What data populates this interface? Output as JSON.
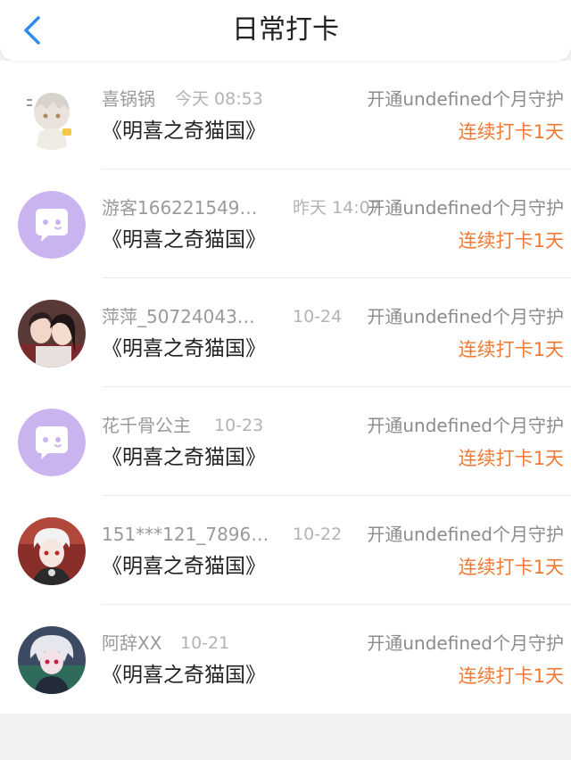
{
  "header": {
    "title": "日常打卡",
    "back_icon": "chevron-left-icon",
    "accent": "#2f8cf0"
  },
  "colors": {
    "streak": "#f07a35",
    "name": "#9a9a9a",
    "time": "#b3b3b3"
  },
  "items": [
    {
      "name": "喜锅锅",
      "time": "今天 08:53",
      "game": "《明喜之奇猫国》",
      "guard": "开通undefined个月守护",
      "streak": "连续打卡1天",
      "avatar": "anime-avatar-icon"
    },
    {
      "name": "游客166221549…",
      "time": "昨天 14:07",
      "game": "《明喜之奇猫国》",
      "guard": "开通undefined个月守护",
      "streak": "连续打卡1天",
      "avatar": "default-chat-avatar-icon"
    },
    {
      "name": "萍萍_50724043…",
      "time": "10-24",
      "game": "《明喜之奇猫国》",
      "guard": "开通undefined个月守护",
      "streak": "连续打卡1天",
      "avatar": "photo-avatar-icon"
    },
    {
      "name": "花千骨公主",
      "time": "10-23",
      "game": "《明喜之奇猫国》",
      "guard": "开通undefined个月守护",
      "streak": "连续打卡1天",
      "avatar": "default-chat-avatar-icon"
    },
    {
      "name": "151***121_7896…",
      "time": "10-22",
      "game": "《明喜之奇猫国》",
      "guard": "开通undefined个月守护",
      "streak": "连续打卡1天",
      "avatar": "anime-avatar-icon"
    },
    {
      "name": "阿辞XX",
      "time": "10-21",
      "game": "《明喜之奇猫国》",
      "guard": "开通undefined个月守护",
      "streak": "连续打卡1天",
      "avatar": "anime-avatar-icon"
    }
  ]
}
